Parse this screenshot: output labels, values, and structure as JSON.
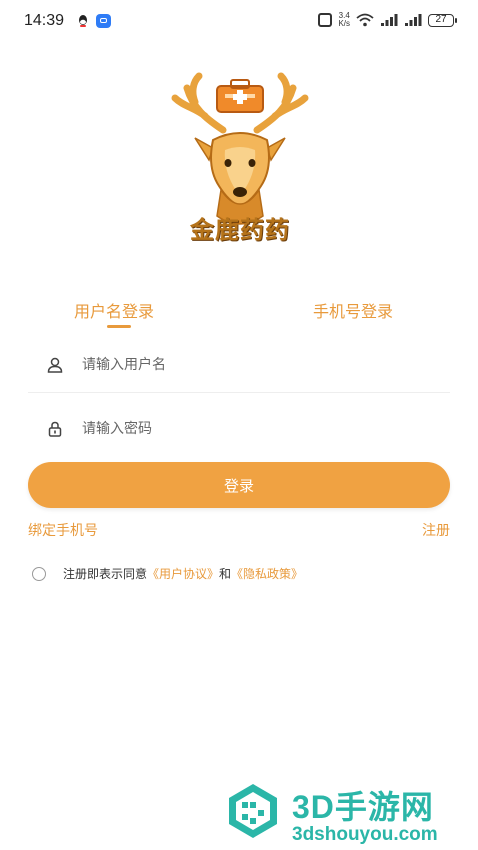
{
  "status_bar": {
    "time": "14:39",
    "speed_top": "3.4",
    "speed_bottom": "K/s",
    "battery": "27"
  },
  "app": {
    "brand_name": "金鹿药药"
  },
  "tabs": [
    {
      "label": "用户名登录",
      "active": true
    },
    {
      "label": "手机号登录",
      "active": false
    }
  ],
  "form": {
    "username_placeholder": "请输入用户名",
    "password_placeholder": "请输入密码",
    "login_button": "登录"
  },
  "links": {
    "bind_phone": "绑定手机号",
    "register": "注册"
  },
  "agreement": {
    "prefix": "注册即表示同意",
    "user_agreement": "《用户协议》",
    "conjunction": "和",
    "privacy_policy": "《隐私政策》"
  },
  "watermark": {
    "title": "3D手游网",
    "domain": "3dshouyou.com"
  },
  "colors": {
    "accent": "#e89a3c",
    "button": "#f0a242",
    "watermark": "#2bb6a8"
  },
  "icons": {
    "username": "user-icon",
    "password": "lock-icon"
  }
}
